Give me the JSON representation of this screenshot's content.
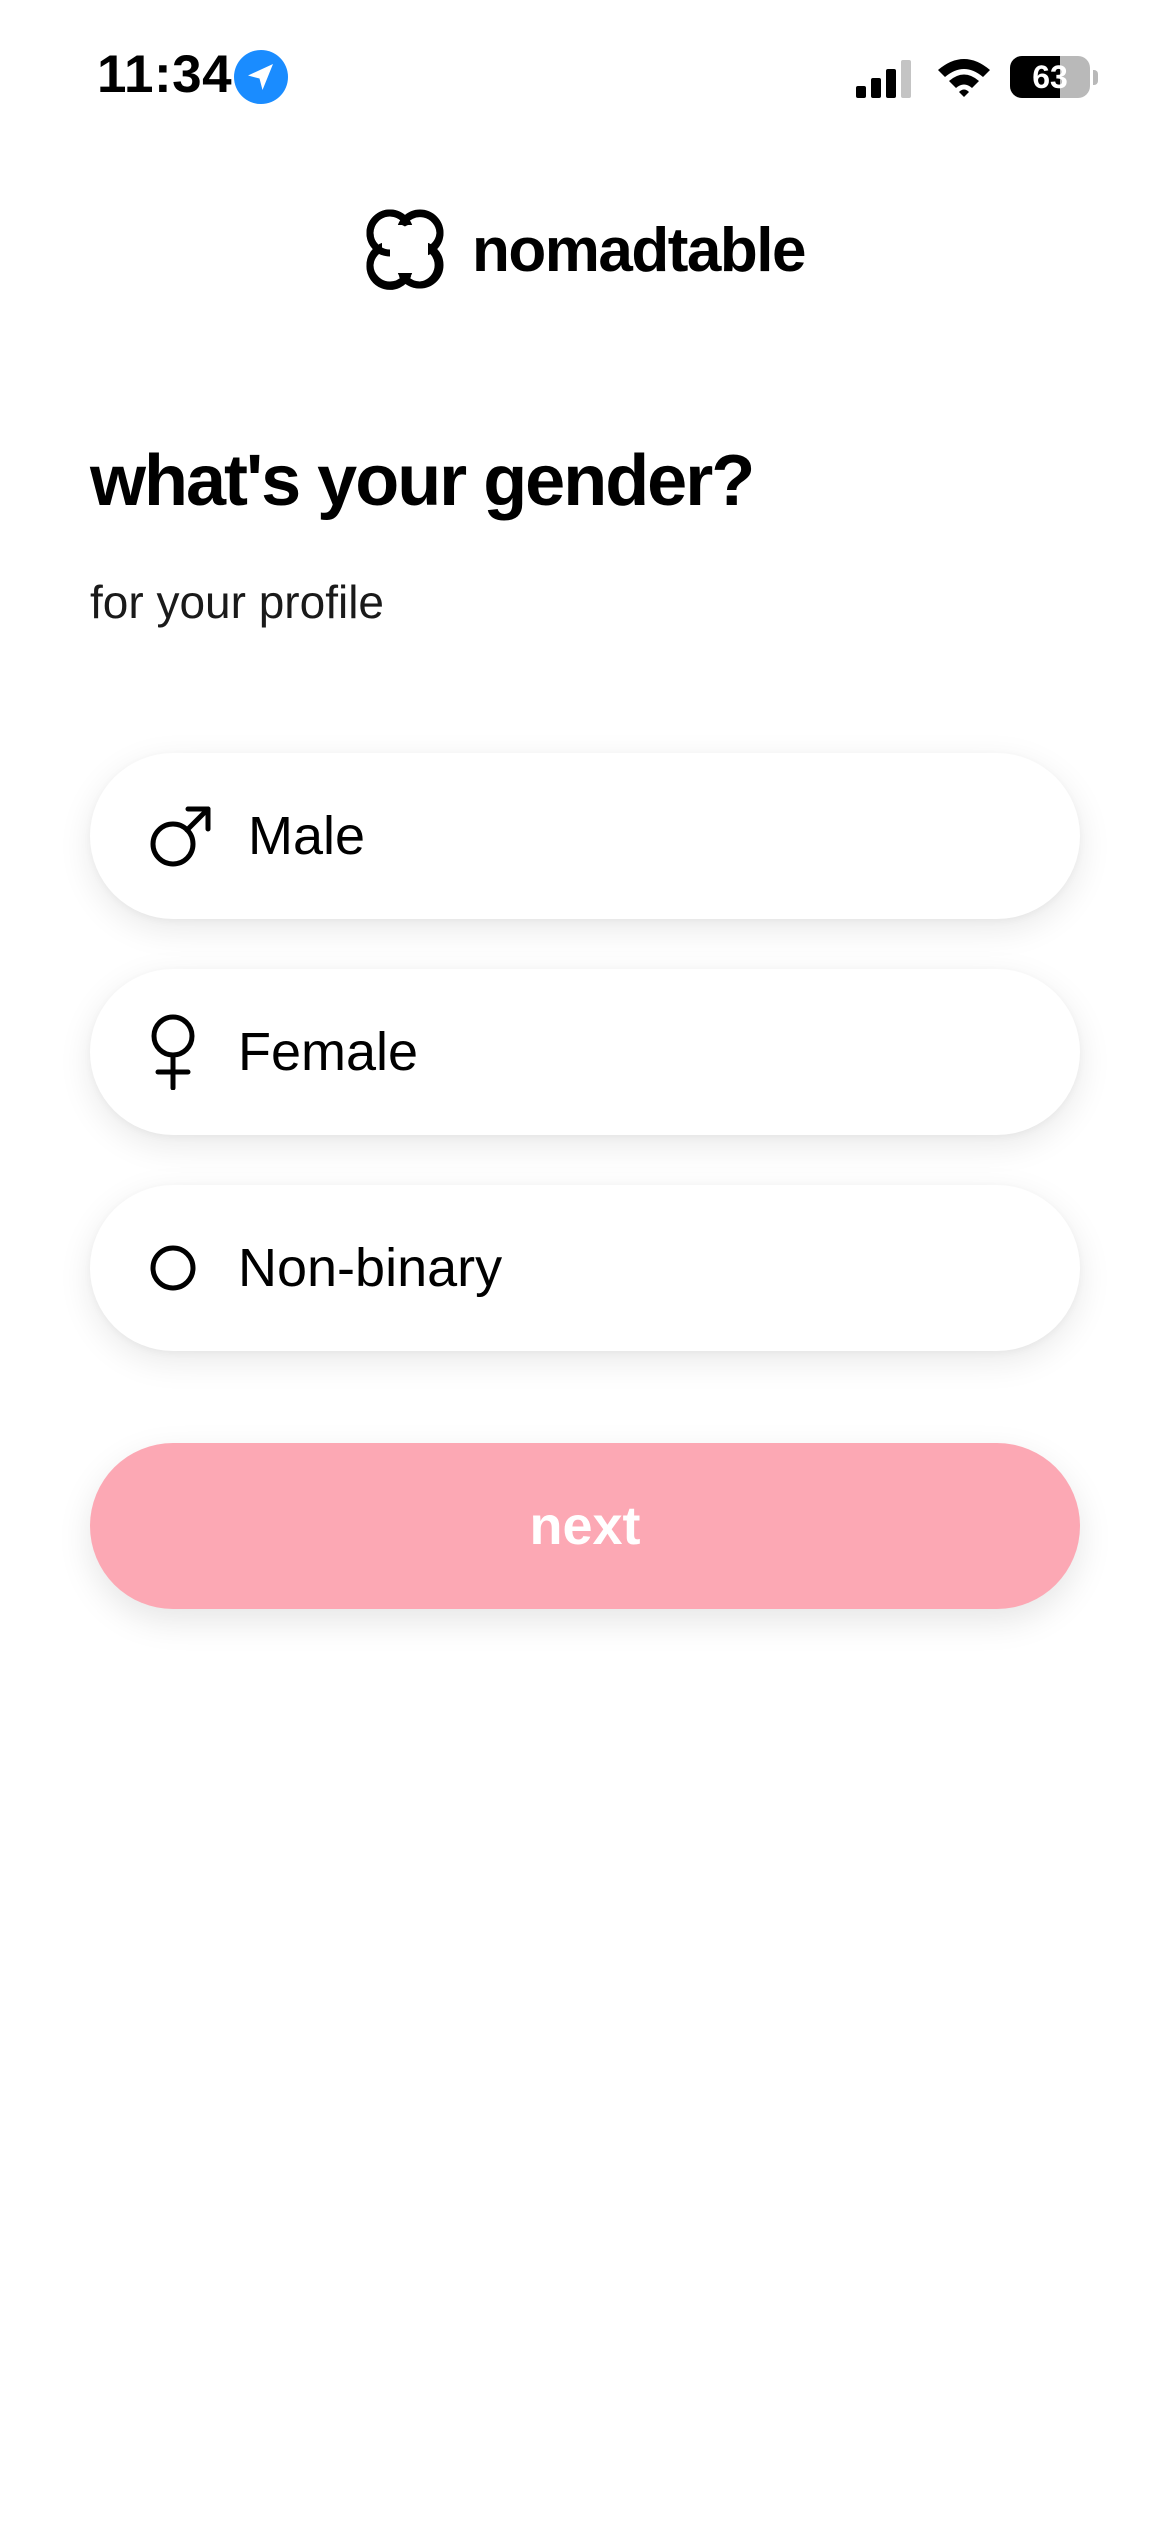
{
  "status_bar": {
    "time": "11:34",
    "battery_percent": "63",
    "battery_level": 0.63,
    "icons": [
      "location-arrow-icon",
      "cellular-signal-icon",
      "wifi-icon",
      "battery-icon"
    ]
  },
  "brand": {
    "name": "nomadtable",
    "logo_icon": "four-circle-logo-icon"
  },
  "heading": {
    "title": "what's your gender?",
    "subtitle": "for your profile"
  },
  "options": [
    {
      "label": "Male",
      "icon": "male-symbol-icon"
    },
    {
      "label": "Female",
      "icon": "female-symbol-icon"
    },
    {
      "label": "Non-binary",
      "icon": "circle-icon"
    }
  ],
  "next_button": {
    "label": "next",
    "color": "#fca8b4",
    "state": "disabled"
  },
  "colors": {
    "location_accent": "#1a8cff",
    "button_pink": "#fca8b4",
    "background": "#ffffff"
  }
}
